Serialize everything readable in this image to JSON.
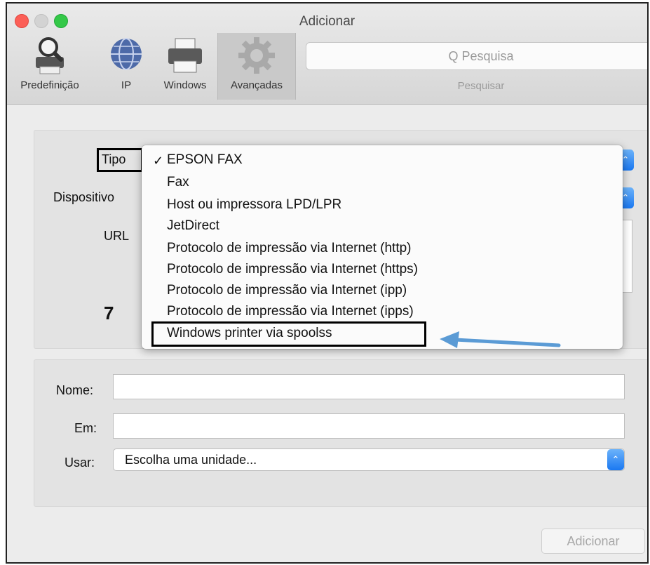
{
  "window": {
    "title": "Adicionar"
  },
  "toolbar": {
    "items": [
      {
        "label": "Predefinição",
        "icon": "magnifier-printer-icon"
      },
      {
        "label": "IP",
        "icon": "globe-icon"
      },
      {
        "label": "Windows",
        "icon": "printer-icon"
      },
      {
        "label": "Avançadas",
        "icon": "gear-icon"
      }
    ],
    "search_placeholder": "Q Pesquisa",
    "search_label": "Pesquisar"
  },
  "form_top": {
    "tipo_label": "Tipo",
    "dispositivo_label": "Dispositivo",
    "url_label": "URL",
    "annotation_number": "7"
  },
  "dropdown": {
    "checkmark": "✓",
    "items": [
      "EPSON FAX",
      "Fax",
      "Host ou impressora LPD/LPR",
      "JetDirect",
      "Protocolo de impressão via Internet (http)",
      "Protocolo de impressão via Internet (https)",
      "Protocolo de impressão via Internet (ipp)",
      "Protocolo de impressão via Internet (ipps)",
      "Windows printer via spoolss"
    ],
    "selected_index": 0,
    "highlighted_index": 8
  },
  "form_bottom": {
    "nome_label": "Nome:",
    "nome_value": "",
    "em_label": "Em:",
    "em_value": "",
    "usar_label": "Usar:",
    "usar_value": "Escolha uma unidade..."
  },
  "footer": {
    "add_button": "Adicionar"
  },
  "colors": {
    "accent": "#1a78f1",
    "annotation_arrow": "#5b9bd5"
  }
}
